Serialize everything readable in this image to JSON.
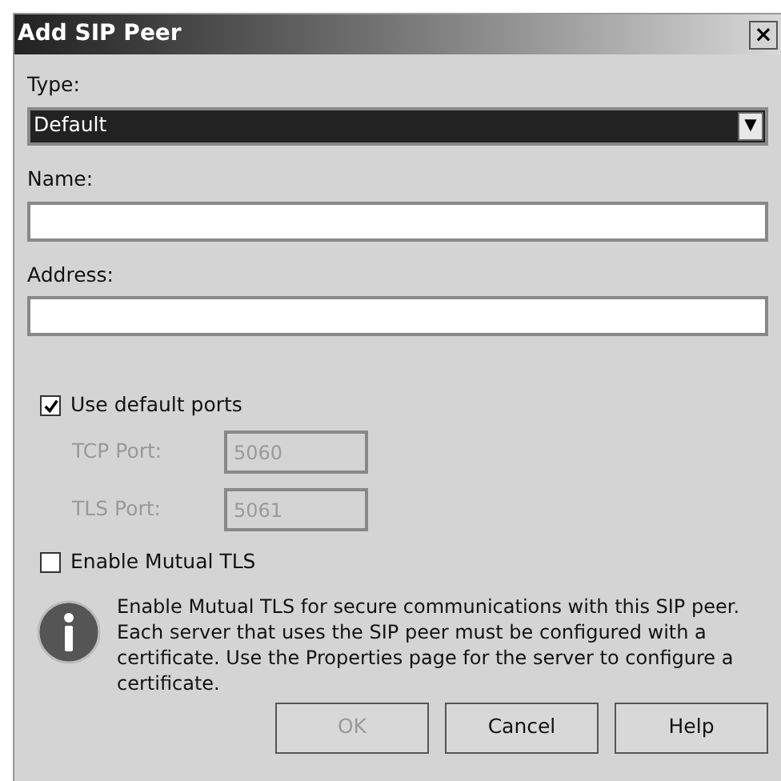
{
  "window": {
    "title": "Add SIP Peer",
    "close": "×"
  },
  "type_field": {
    "label": "Type:",
    "value": "Default",
    "arrow": "▼"
  },
  "name_field": {
    "label": "Name:"
  },
  "address_field": {
    "label": "Address:"
  },
  "use_default_ports": {
    "label": "Use default ports",
    "checked": true
  },
  "ports": [
    {
      "label": "TCP Port:",
      "value": "5060",
      "disabled": true
    },
    {
      "label": "TLS Port:",
      "value": "5061",
      "disabled": true
    }
  ],
  "mutual_tls": {
    "label": "Enable Mutual TLS",
    "checked": false
  },
  "info": "Enable Mutual TLS for secure communications with this SIP peer. Each server that uses the SIP peer must be configured with a certificate. Use the Properties page for the server to configure a certificate.",
  "buttons": [
    {
      "label": "OK",
      "disabled": true
    },
    {
      "label": "Cancel",
      "disabled": false
    },
    {
      "label": "Help",
      "disabled": false
    }
  ]
}
